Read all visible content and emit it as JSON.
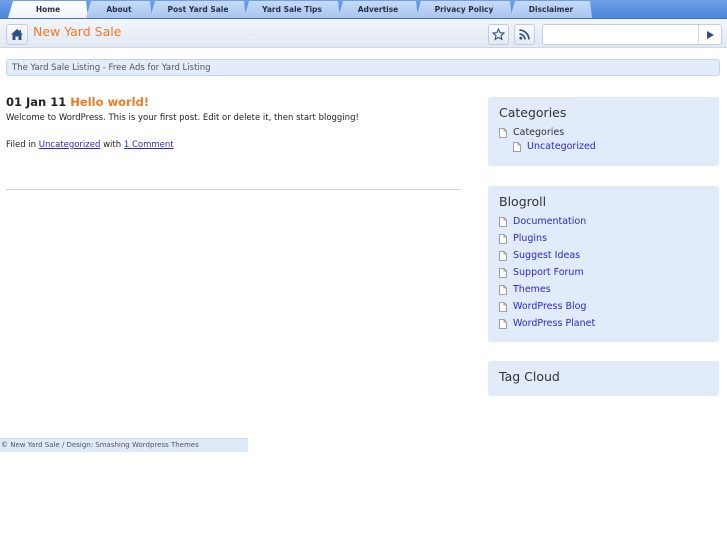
{
  "nav": {
    "tabs": [
      {
        "label": "Home",
        "active": true
      },
      {
        "label": "About",
        "active": false
      },
      {
        "label": "Post Yard Sale",
        "active": false
      },
      {
        "label": "Yard Sale Tips",
        "active": false
      },
      {
        "label": "Advertise",
        "active": false
      },
      {
        "label": "Privacy Policy",
        "active": false
      },
      {
        "label": "Disclaimer",
        "active": false
      }
    ]
  },
  "header": {
    "site_title": "New Yard Sale",
    "home_icon": "home-icon",
    "bookmark_icon": "star-icon",
    "rss_icon": "rss-icon",
    "search": {
      "value": "",
      "placeholder": ""
    },
    "search_go_icon": "play-arrow-icon"
  },
  "description": "The Yard Sale Listing - Free Ads for Yard Listing",
  "post": {
    "date": "01 Jan 11",
    "title": "Hello world!",
    "body": "Welcome to WordPress. This is your first post. Edit or delete it, then start blogging!",
    "meta_prefix": "Filed in",
    "category_link": "Uncategorized",
    "meta_middle": "with",
    "comments_link": "1 Comment"
  },
  "sidebar": {
    "categories": {
      "title": "Categories",
      "parent": "Categories",
      "children": [
        "Uncategorized"
      ]
    },
    "blogroll": {
      "title": "Blogroll",
      "links": [
        "Documentation",
        "Plugins",
        "Suggest Ideas",
        "Support Forum",
        "Themes",
        "WordPress Blog",
        "WordPress Planet"
      ]
    },
    "tagcloud": {
      "title": "Tag Cloud"
    }
  },
  "footer": {
    "text": "© New Yard Sale / Design: Smashing Wordpress Themes"
  },
  "colors": {
    "accent": "#f07a24",
    "link": "#2a2acc",
    "widget_bg": "#e1ebfa",
    "tabbar": "#4a86dc"
  }
}
